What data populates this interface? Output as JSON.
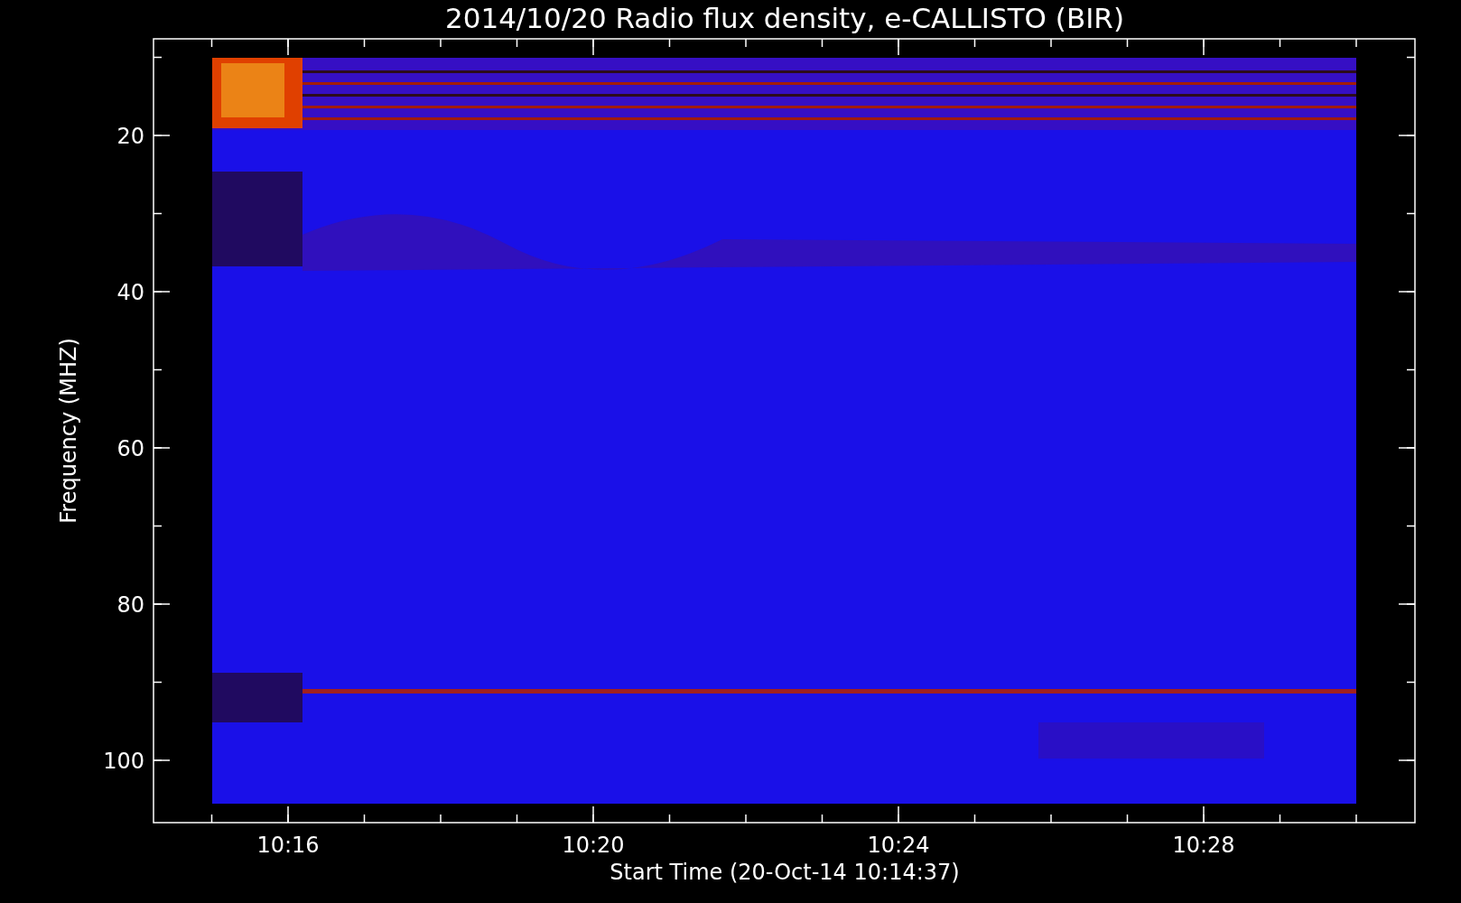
{
  "title": "2014/10/20  Radio flux density, e-CALLISTO (BIR)",
  "y_axis": {
    "label": "Frequency (MHZ)",
    "tick_labels": [
      "20",
      "40",
      "60",
      "80",
      "100"
    ]
  },
  "x_axis": {
    "label": "Start Time (20-Oct-14 10:14:37)",
    "tick_labels": [
      "10:16",
      "10:20",
      "10:24",
      "10:28"
    ]
  }
}
